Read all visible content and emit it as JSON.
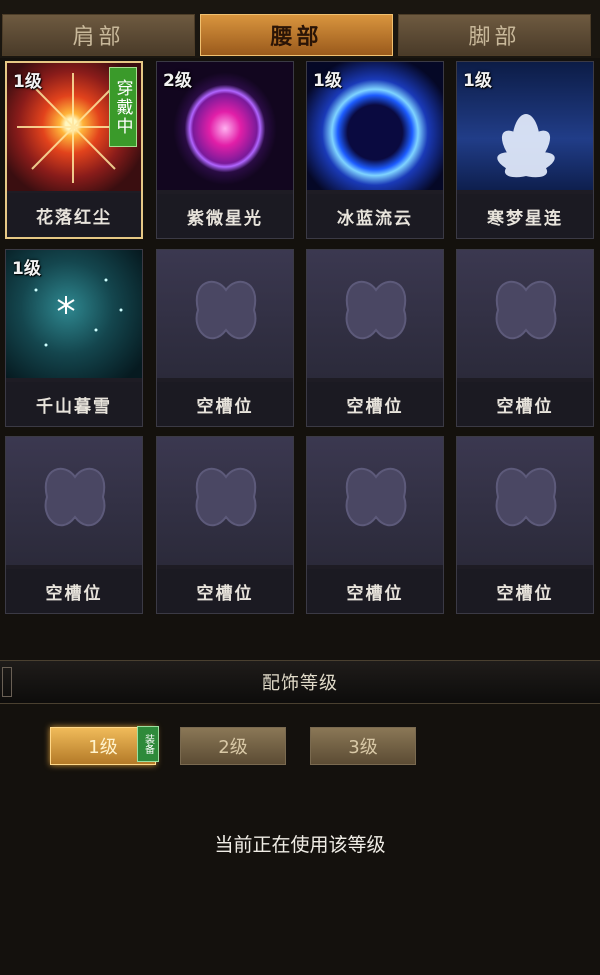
{
  "tabs": [
    {
      "label": "肩部",
      "active": false
    },
    {
      "label": "腰部",
      "active": true
    },
    {
      "label": "脚部",
      "active": false
    }
  ],
  "slots": [
    {
      "name": "花落红尘",
      "level": "1级",
      "wearing": "穿戴中",
      "icon": "red-starburst-icon"
    },
    {
      "name": "紫微星光",
      "level": "2级",
      "icon": "purple-orb-icon"
    },
    {
      "name": "冰蓝流云",
      "level": "1级",
      "icon": "blue-swirl-icon"
    },
    {
      "name": "寒梦星连",
      "level": "1级",
      "icon": "white-lotus-icon"
    },
    {
      "name": "千山暮雪",
      "level": "1级",
      "icon": "snowflake-icon"
    },
    {
      "name": "空槽位",
      "icon": "butterfly-icon"
    },
    {
      "name": "空槽位",
      "icon": "butterfly-icon"
    },
    {
      "name": "空槽位",
      "icon": "butterfly-icon"
    },
    {
      "name": "空槽位",
      "icon": "butterfly-icon"
    },
    {
      "name": "空槽位",
      "icon": "butterfly-icon"
    },
    {
      "name": "空槽位",
      "icon": "butterfly-icon"
    },
    {
      "name": "空槽位",
      "icon": "butterfly-icon"
    }
  ],
  "section_title": "配饰等级",
  "level_buttons": [
    {
      "label": "1级",
      "active": true
    },
    {
      "label": "2级",
      "active": false
    },
    {
      "label": "3级",
      "active": false
    }
  ],
  "equip_badge": "装备",
  "status_text": "当前正在使用该等级",
  "colors": {
    "accent_gold": "#e6c885",
    "active_tab": "#d9953e",
    "wearing_green": "#3a9a2a"
  }
}
